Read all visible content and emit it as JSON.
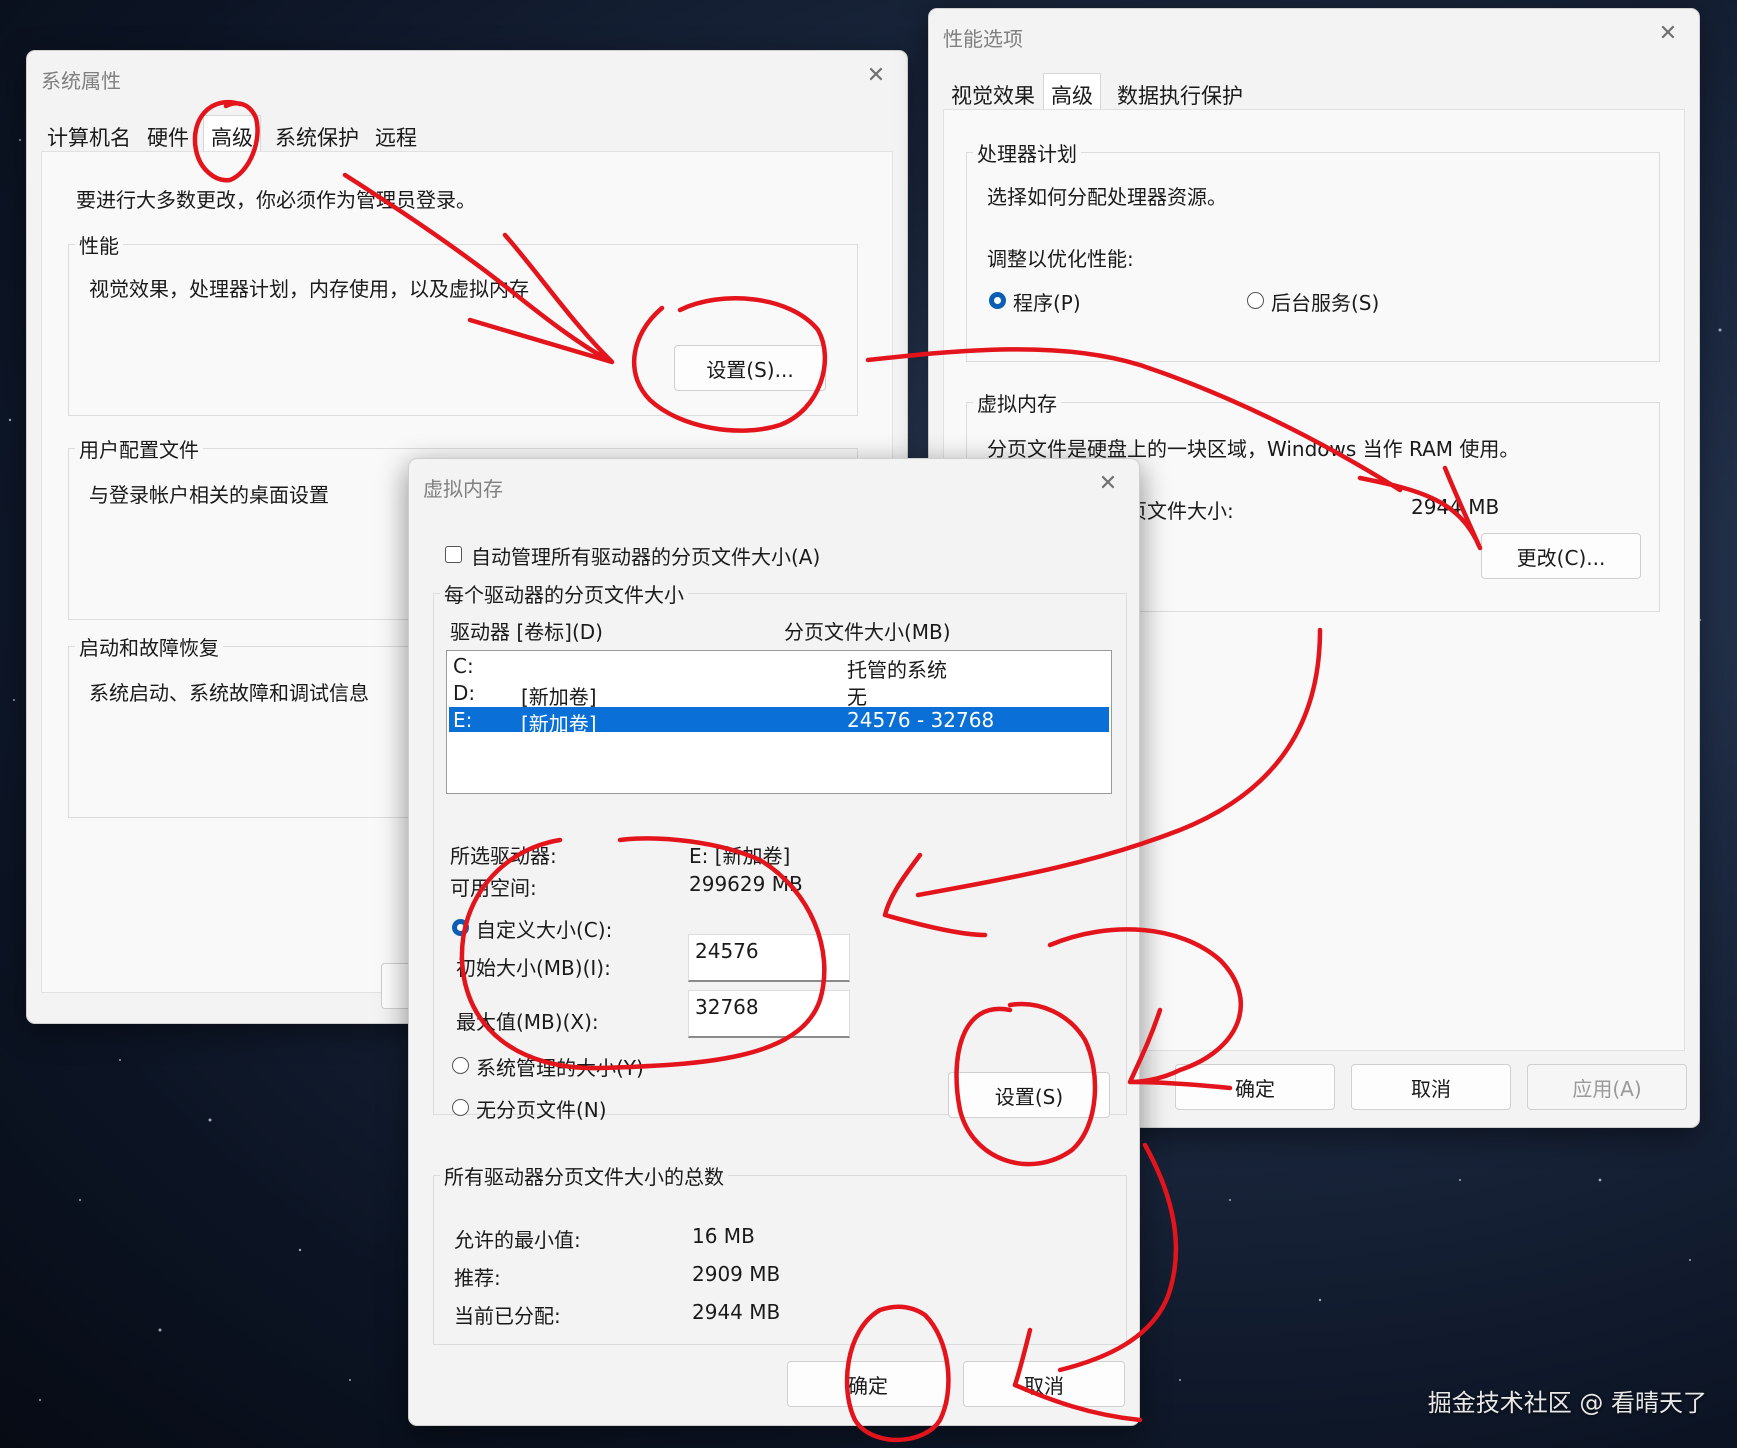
{
  "sysprops": {
    "title": "系统属性",
    "tabs": [
      "计算机名",
      "硬件",
      "高级",
      "系统保护",
      "远程"
    ],
    "admin_note": "要进行大多数更改，你必须作为管理员登录。",
    "performance": {
      "label": "性能",
      "desc": "视觉效果，处理器计划，内存使用，以及虚拟内存",
      "button": "设置(S)..."
    },
    "user_profile": {
      "label": "用户配置文件",
      "desc": "与登录帐户相关的桌面设置"
    },
    "startup": {
      "label": "启动和故障恢复",
      "desc": "系统启动、系统故障和调试信息"
    }
  },
  "perfopts": {
    "title": "性能选项",
    "tabs": [
      "视觉效果",
      "高级",
      "数据执行保护"
    ],
    "processor": {
      "label": "处理器计划",
      "desc": "选择如何分配处理器资源。",
      "adjust": "调整以优化性能:",
      "opt_programs": "程序(P)",
      "opt_services": "后台服务(S)"
    },
    "vm": {
      "label": "虚拟内存",
      "desc": "分页文件是硬盘上的一块区域，Windows 当作 RAM 使用。",
      "total_label": "所有驱动器总分页文件大小:",
      "total_value": "2944 MB",
      "change": "更改(C)..."
    },
    "ok": "确定",
    "cancel": "取消",
    "apply": "应用(A)"
  },
  "vmdlg": {
    "title": "虚拟内存",
    "auto_manage": "自动管理所有驱动器的分页文件大小(A)",
    "per_drive_label": "每个驱动器的分页文件大小",
    "col_drive": "驱动器 [卷标](D)",
    "col_size": "分页文件大小(MB)",
    "drives": [
      {
        "drive": "C:",
        "label": "",
        "size": "托管的系统"
      },
      {
        "drive": "D:",
        "label": "[新加卷]",
        "size": "无"
      },
      {
        "drive": "E:",
        "label": "[新加卷]",
        "size": "24576 - 32768"
      }
    ],
    "selected_drive_label": "所选驱动器:",
    "selected_drive_value": "E:  [新加卷]",
    "free_label": "可用空间:",
    "free_value": "299629 MB",
    "custom_size": "自定义大小(C):",
    "initial_label": "初始大小(MB)(I):",
    "initial_value": "24576",
    "max_label": "最大值(MB)(X):",
    "max_value": "32768",
    "system_managed": "系统管理的大小(Y)",
    "no_paging": "无分页文件(N)",
    "set_button": "设置(S)",
    "totals_label": "所有驱动器分页文件大小的总数",
    "min_label": "允许的最小值:",
    "min_value": "16 MB",
    "rec_label": "推荐:",
    "rec_value": "2909 MB",
    "cur_label": "当前已分配:",
    "cur_value": "2944 MB",
    "ok": "确定",
    "cancel": "取消"
  },
  "watermark": "掘金技术社区 @ 看晴天了",
  "colors": {
    "accent": "#0a6fd6",
    "annotation": "#e3141b"
  }
}
